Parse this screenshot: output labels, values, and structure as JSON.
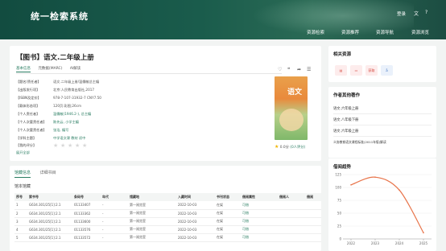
{
  "header": {
    "brand": "统一检索系统",
    "login": "登录",
    "nav": [
      "资源检索",
      "资源推荐",
      "资源导航",
      "资源浏览"
    ]
  },
  "book": {
    "title": "【图书】语文.二年级上册",
    "tabs": [
      "基本信息",
      "元数据(MARC)",
      "AI解读"
    ],
    "fields": [
      {
        "label": "【题名/责任者】",
        "value": "语文.二年级上册/温儒敏总主编"
      },
      {
        "label": "【出版发行项】",
        "value": "北京:人民教育出版社,2017"
      },
      {
        "label": "【ISBN及定价】",
        "value": "978-7-107-31932-7 CNY7.50"
      },
      {
        "label": "【载体形态项】",
        "value": "120页:彩图;26cm"
      },
      {
        "label": "【个人责任者】",
        "value": "温儒敏(1946.2-), 总主编"
      },
      {
        "label": "【个人次要责任者】",
        "value": "陈先云, 小学主编"
      },
      {
        "label": "【个人次要责任者】",
        "value": "张浩, 编写"
      },
      {
        "label": "【学科主题】",
        "value": "中学语文课 教材 初中"
      },
      {
        "label": "【我的评分】",
        "value": ""
      }
    ],
    "expand": "展开全部",
    "cover_text": "语文",
    "score": "0.0分",
    "score_count": "(0人评分)"
  },
  "holdings": {
    "tabs": [
      "馆藏信息",
      "详细书目"
    ],
    "subtitle": "馆本馆藏",
    "columns": [
      "序号",
      "索书号",
      "条码号",
      "年代",
      "馆藏地",
      "入藏时间",
      "书刊状态",
      "借阅属性",
      "借阅人",
      "借阅"
    ],
    "rows": [
      [
        "1",
        "G634.301/25[1]:2.1",
        "01133407",
        "-",
        "第一阅览室",
        "2022-10-03",
        "在架",
        "可借",
        "",
        ""
      ],
      [
        "2",
        "G634.301/25[1]:2.1",
        "01133362",
        "-",
        "第一阅览室",
        "2022-10-03",
        "在架",
        "可借",
        "",
        ""
      ],
      [
        "3",
        "G634.301/25[1]:2.1",
        "01133600",
        "-",
        "第一阅览室",
        "2022-10-03",
        "在架",
        "可借",
        "",
        ""
      ],
      [
        "4",
        "G634.301/25[1]:2.1",
        "01133576",
        "-",
        "第一阅览室",
        "2022-10-03",
        "在架",
        "可借",
        "",
        ""
      ],
      [
        "5",
        "G634.301/25[1]:2.1",
        "01133572",
        "-",
        "第一阅览室",
        "2022-10-03",
        "在架",
        "可借",
        "",
        ""
      ]
    ]
  },
  "side": {
    "related_title": "相关资源",
    "related_items": [
      "",
      "",
      "获取",
      ""
    ],
    "other_title": "作者其他著作",
    "other_works": [
      "语文.六年级上册",
      "语文.八年级下册",
      "语文.六年级上册",
      "义务教育语文课程标准(2011年版)解读"
    ],
    "trend_title": "借阅趋势"
  },
  "chart_data": {
    "type": "line",
    "title": "",
    "x": [
      "2022",
      "2023",
      "2024",
      "2025"
    ],
    "values": [
      105,
      120,
      95,
      12
    ],
    "yticks": [
      0,
      25,
      50,
      75,
      100,
      125
    ],
    "ylim": [
      0,
      125
    ],
    "color": "#e8744a",
    "grid": true
  }
}
